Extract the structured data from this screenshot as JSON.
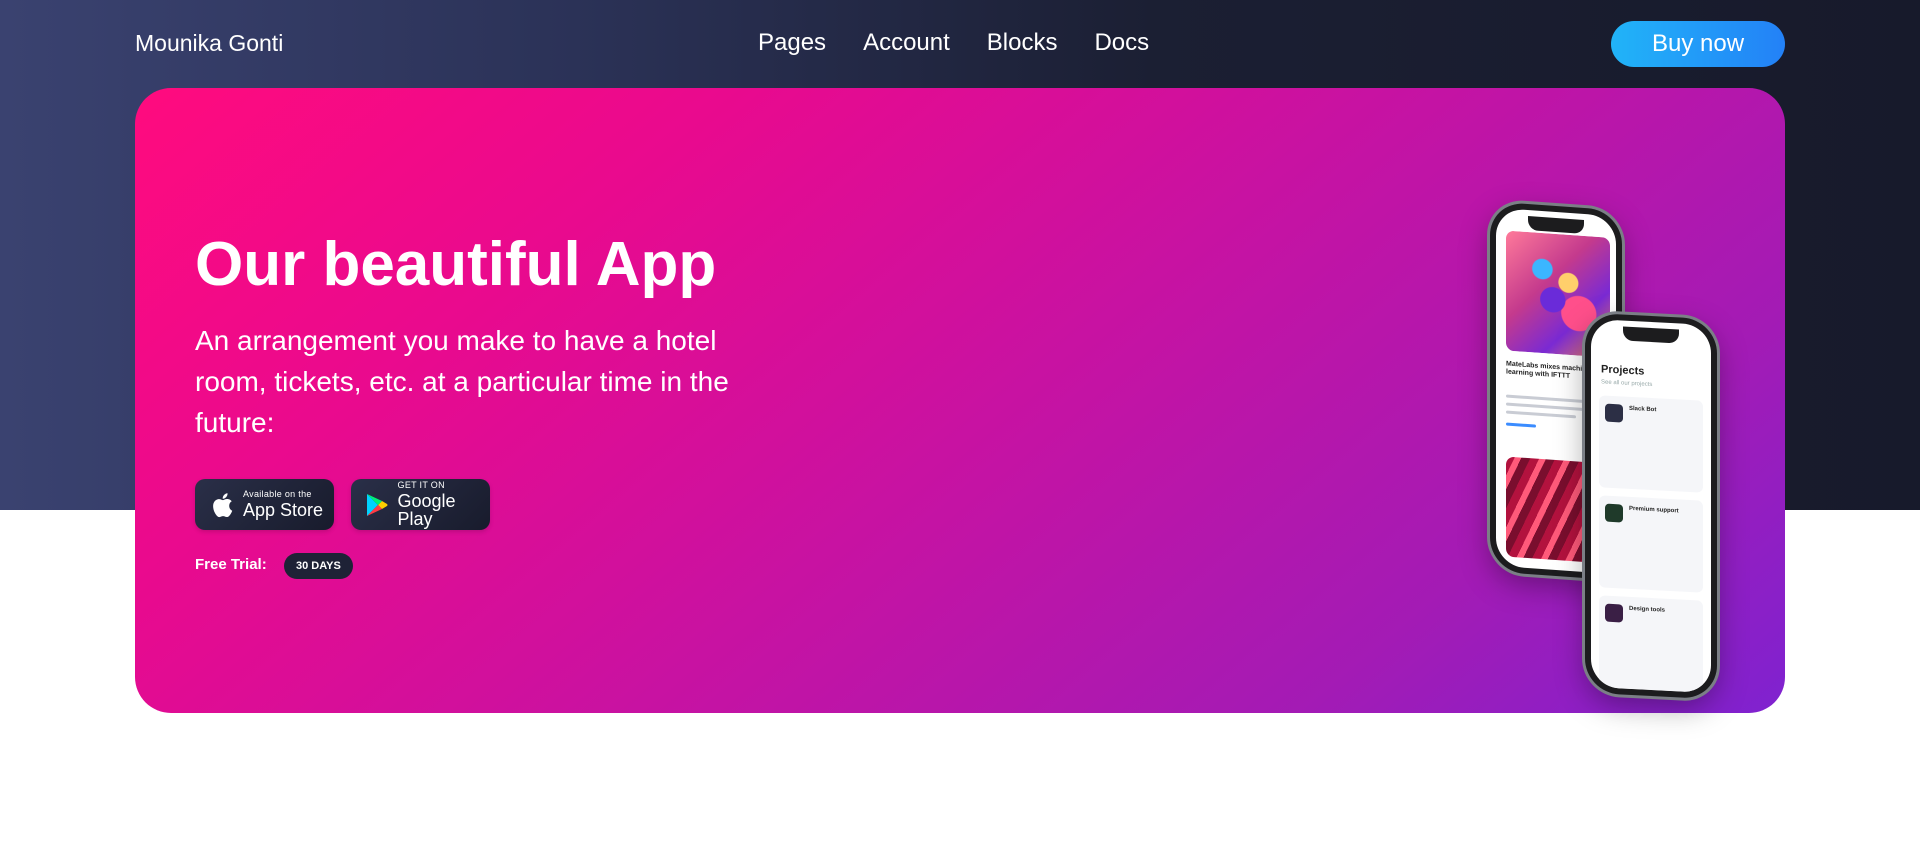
{
  "navbar": {
    "brand": "Mounika Gonti",
    "links": [
      "Pages",
      "Account",
      "Blocks",
      "Docs"
    ],
    "cta_label": "Buy now"
  },
  "hero": {
    "title": "Our beautiful App",
    "subtitle": "An arrangement you make to have a hotel room, tickets, etc. at a particular time in the future:",
    "app_store": {
      "small": "Available on the",
      "big": "App Store"
    },
    "google_play": {
      "small": "GET IT ON",
      "big": "Google Play"
    },
    "trial_label": "Free Trial:",
    "trial_badge": "30 DAYS"
  },
  "phone_back": {
    "article_title": "MateLabs mixes machine learning with IFTTT"
  },
  "phone_front": {
    "title": "Projects",
    "subtitle": "See all our projects",
    "projects": [
      "Slack Bot",
      "Premium support",
      "Design tools"
    ]
  },
  "colors": {
    "accent_blue": "#2381f7",
    "hero_pink": "#ff0b7e",
    "hero_purple": "#7f22d0",
    "header_dark": "#171a2b"
  }
}
